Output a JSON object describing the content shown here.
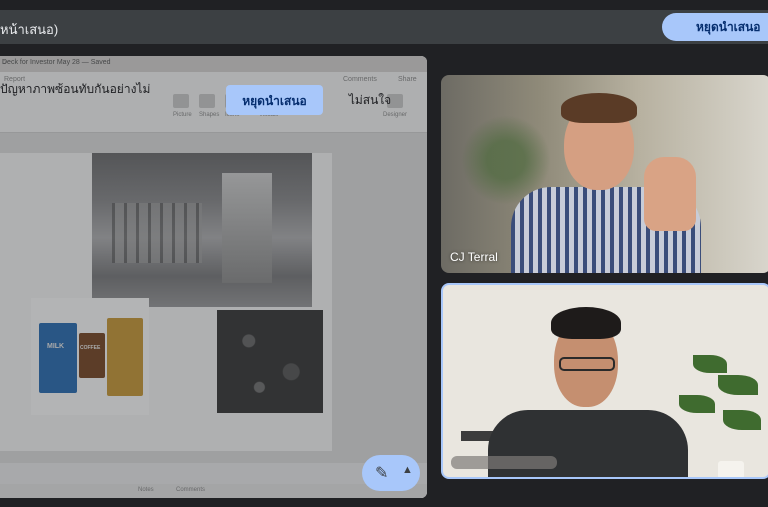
{
  "banner": {
    "text": "หน้าเสนอ)",
    "stop_label": "หยุดนำเสนอ"
  },
  "shared_screen": {
    "doc_title": "Deck for Investor May 28 — Saved",
    "ribbon_tabs": [
      "Report",
      "Comments",
      "Share"
    ],
    "ribbon_labels": [
      "Picture",
      "Shapes",
      "Icons",
      "Visuals",
      "Designer"
    ],
    "overlay_message": "ปัญหาภาพซ้อนทับกันอย่างไม่",
    "overlay_stop_label": "หยุดนำเสนอ",
    "overlay_ignore_label": "ไม่สนใจ",
    "status_notes": "Notes",
    "status_comments": "Comments",
    "products": {
      "milk": "MILK",
      "coffee": "COFFEE"
    }
  },
  "participants": [
    {
      "name": "CJ Terral"
    },
    {
      "name": ""
    }
  ],
  "colors": {
    "accent": "#a8c7fa",
    "background": "#202124",
    "banner": "#3c4043"
  }
}
